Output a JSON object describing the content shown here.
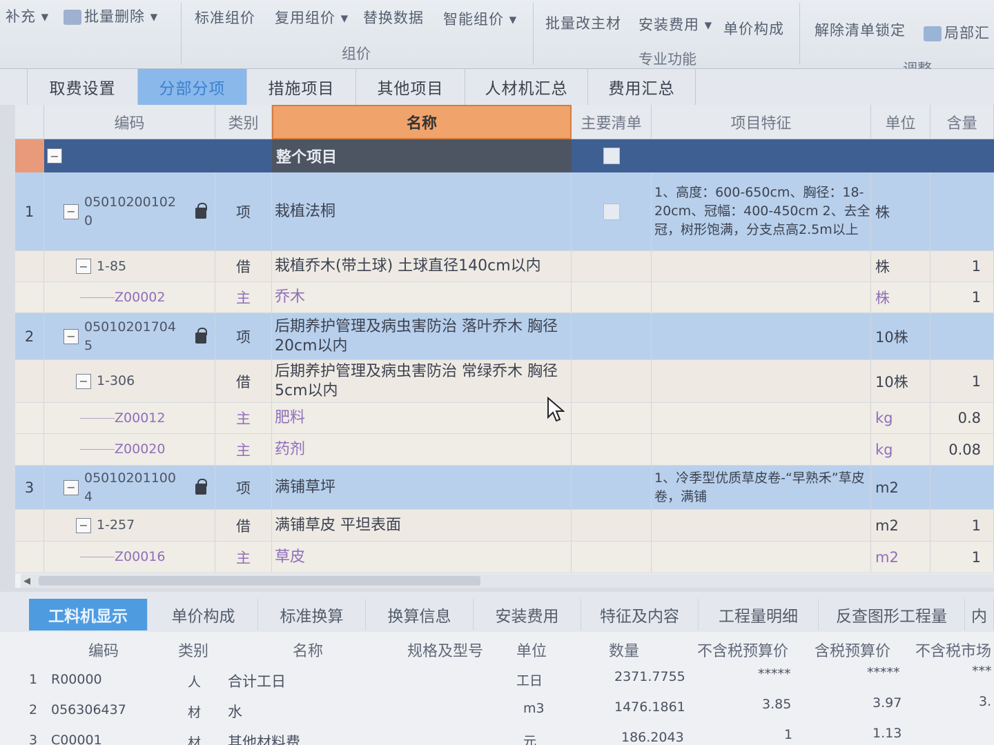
{
  "ribbon": {
    "buttons": [
      "补充",
      "批量删除",
      "标准组价",
      "复用组价",
      "替换数据",
      "智能组价",
      "批量改主材",
      "安装费用",
      "单价构成",
      "解除清单锁定",
      "局部汇"
    ],
    "groups": [
      "组价",
      "专业功能",
      "调整"
    ]
  },
  "tabs": [
    "取费设置",
    "分部分项",
    "措施项目",
    "其他项目",
    "人材机汇总",
    "费用汇总"
  ],
  "active_tab": "分部分项",
  "grid": {
    "columns": [
      "编码",
      "类别",
      "名称",
      "主要清单",
      "项目特征",
      "单位",
      "含量"
    ],
    "root_row": {
      "name": "整个项目"
    },
    "rows": [
      {
        "no": "1",
        "code": "050102001020",
        "code_l1": "05010200102",
        "code_l2": "0",
        "type": "项",
        "name": "栽植法桐",
        "feature": "1、高度：600-650cm、胸径：18-20cm、冠幅：400-450cm 2、去全冠，树形饱满，分支点高2.5m以上",
        "unit": "株",
        "qty": ""
      },
      {
        "no": "",
        "code": "1-85",
        "type": "借",
        "name": "栽植乔木(带土球) 土球直径140cm以内",
        "feature": "",
        "unit": "株",
        "qty": "1"
      },
      {
        "no": "",
        "code": "Z00002",
        "type": "主",
        "name": "乔木",
        "feature": "",
        "unit": "株",
        "qty": "1"
      },
      {
        "no": "2",
        "code": "050102017045",
        "code_l1": "05010201704",
        "code_l2": "5",
        "type": "项",
        "name": "后期养护管理及病虫害防治 落叶乔木 胸径20cm以内",
        "feature": "",
        "unit": "10株",
        "qty": ""
      },
      {
        "no": "",
        "code": "1-306",
        "type": "借",
        "name": "后期养护管理及病虫害防治 常绿乔木 胸径5cm以内",
        "feature": "",
        "unit": "10株",
        "qty": "1"
      },
      {
        "no": "",
        "code": "Z00012",
        "type": "主",
        "name": "肥料",
        "feature": "",
        "unit": "kg",
        "qty": "0.8"
      },
      {
        "no": "",
        "code": "Z00020",
        "type": "主",
        "name": "药剂",
        "feature": "",
        "unit": "kg",
        "qty": "0.08"
      },
      {
        "no": "3",
        "code": "050102011004",
        "code_l1": "05010201100",
        "code_l2": "4",
        "type": "项",
        "name": "满铺草坪",
        "feature": "1、冷季型优质草皮卷-“早熟禾”草皮卷，满铺",
        "unit": "m2",
        "qty": ""
      },
      {
        "no": "",
        "code": "1-257",
        "type": "借",
        "name": "满铺草皮 平坦表面",
        "feature": "",
        "unit": "m2",
        "qty": "1"
      },
      {
        "no": "",
        "code": "Z00016",
        "type": "主",
        "name": "草皮",
        "feature": "",
        "unit": "m2",
        "qty": "1"
      }
    ]
  },
  "bottom_tabs": [
    "工料机显示",
    "单价构成",
    "标准换算",
    "换算信息",
    "安装费用",
    "特征及内容",
    "工程量明细",
    "反查图形工程量",
    "内"
  ],
  "bottom_active": "工料机显示",
  "bottom_grid": {
    "columns": [
      "编码",
      "类别",
      "名称",
      "规格及型号",
      "单位",
      "数量",
      "不含税预算价",
      "含税预算价",
      "不含税市场"
    ],
    "rows": [
      {
        "no": "1",
        "code": "R00000",
        "type": "人",
        "name": "合计工日",
        "spec": "",
        "unit": "工日",
        "qty": "2371.7755",
        "price_ex": "*****",
        "price_in": "*****",
        "market": "***"
      },
      {
        "no": "2",
        "code": "056306437",
        "type": "材",
        "name": "水",
        "spec": "",
        "unit": "m3",
        "qty": "1476.1861",
        "price_ex": "3.85",
        "price_in": "3.97",
        "market": "3."
      },
      {
        "no": "3",
        "code": "C00001",
        "type": "材",
        "name": "其他材料费",
        "spec": "",
        "unit": "元",
        "qty": "186.2043",
        "price_ex": "1",
        "price_in": "1.13",
        "market": ""
      }
    ]
  }
}
